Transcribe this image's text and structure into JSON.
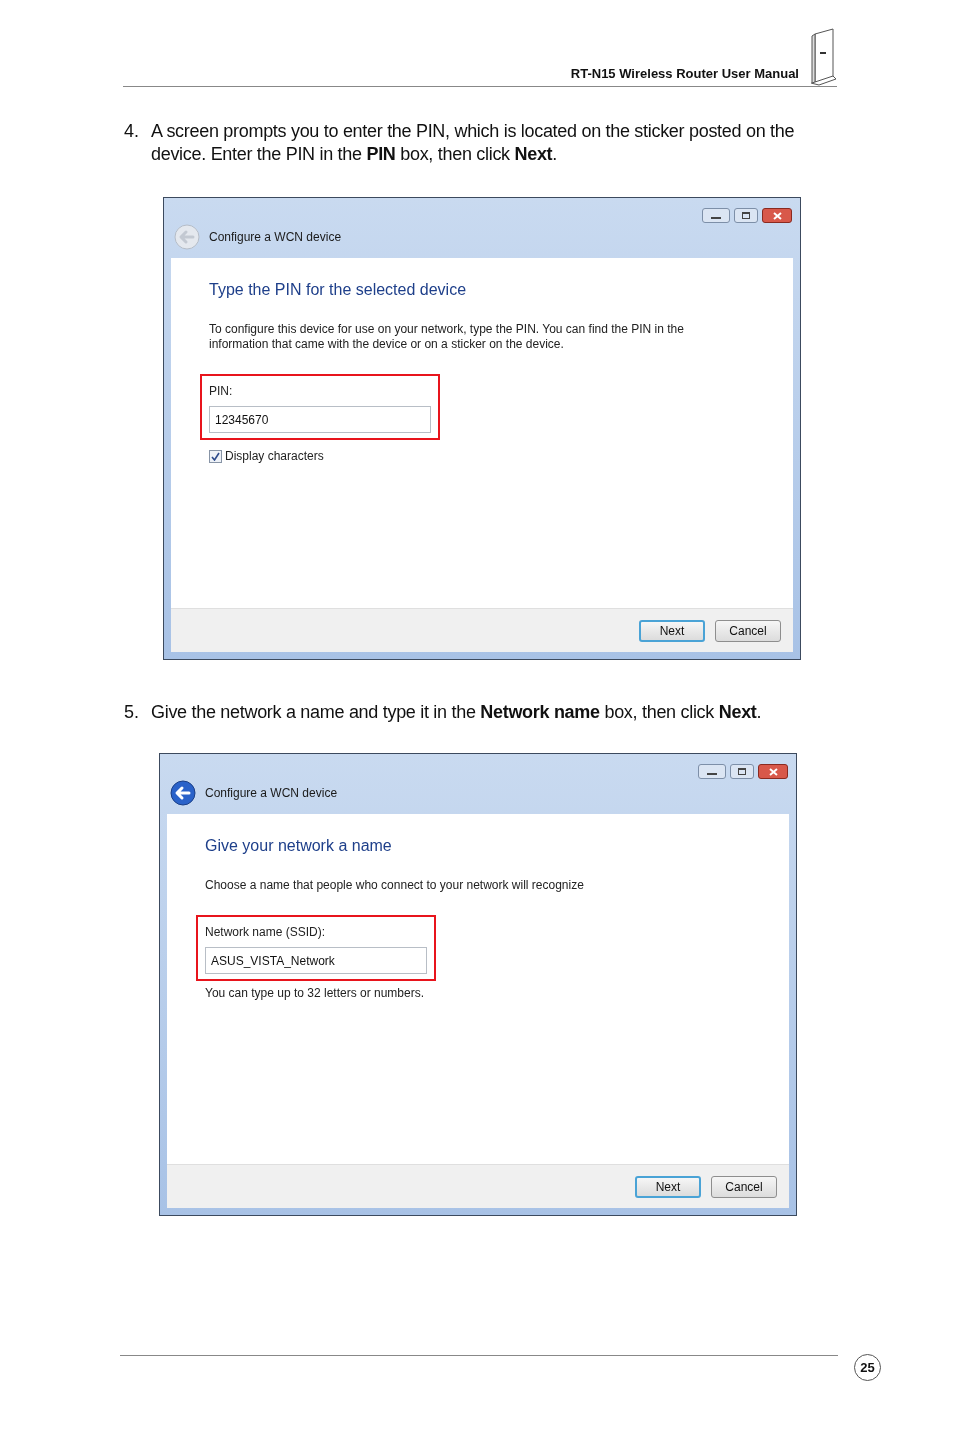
{
  "header": {
    "title": "RT-N15 Wireless Router User Manual"
  },
  "steps": [
    {
      "number": "4.",
      "text": "A screen prompts you to enter the PIN, which is located on the sticker posted on the device. Enter the PIN in the **PIN** box, then click **Next**.",
      "window": {
        "title": "Configure a WCN device",
        "back_enabled": false,
        "heading": "Type the PIN for the selected device",
        "description": "To configure this device for use on your network, type the PIN. You can find the PIN in the information that came with the device or on a sticker on the device.",
        "field": {
          "label": "PIN:",
          "value": "12345670",
          "highlighted": true
        },
        "checkbox": {
          "label": "Display characters",
          "checked": true
        },
        "buttons": [
          {
            "label": "Next",
            "default": true
          },
          {
            "label": "Cancel",
            "default": false
          }
        ]
      }
    },
    {
      "number": "5.",
      "text": "Give the network a name and type it in the **Network name** box, then click **Next**.",
      "window": {
        "title": "Configure a WCN device",
        "back_enabled": true,
        "heading": "Give your network a name",
        "description": "Choose a name that people who connect to your network will recognize",
        "field": {
          "label": "Network name (SSID):",
          "value": "ASUS_VISTA_Network",
          "highlighted": true
        },
        "note": "You can type up to 32 letters or numbers.",
        "buttons": [
          {
            "label": "Next",
            "default": true
          },
          {
            "label": "Cancel",
            "default": false
          }
        ]
      }
    }
  ],
  "page_number": "25"
}
